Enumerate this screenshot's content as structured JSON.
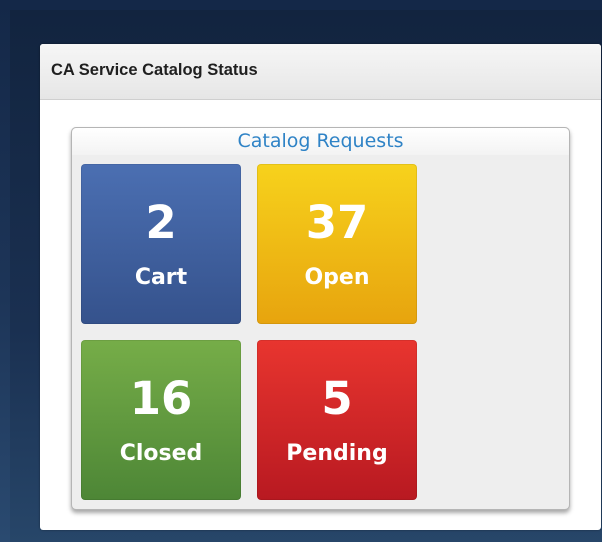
{
  "widget": {
    "title": "CA Service Catalog Status"
  },
  "catalog_requests": {
    "title": "Catalog Requests",
    "tiles": [
      {
        "count": "2",
        "label": "Cart",
        "color": "#3f5f9f"
      },
      {
        "count": "37",
        "label": "Open",
        "color": "#f0be15"
      },
      {
        "count": "16",
        "label": "Closed",
        "color": "#62993f"
      },
      {
        "count": "5",
        "label": "Pending",
        "color": "#d02628"
      }
    ]
  }
}
